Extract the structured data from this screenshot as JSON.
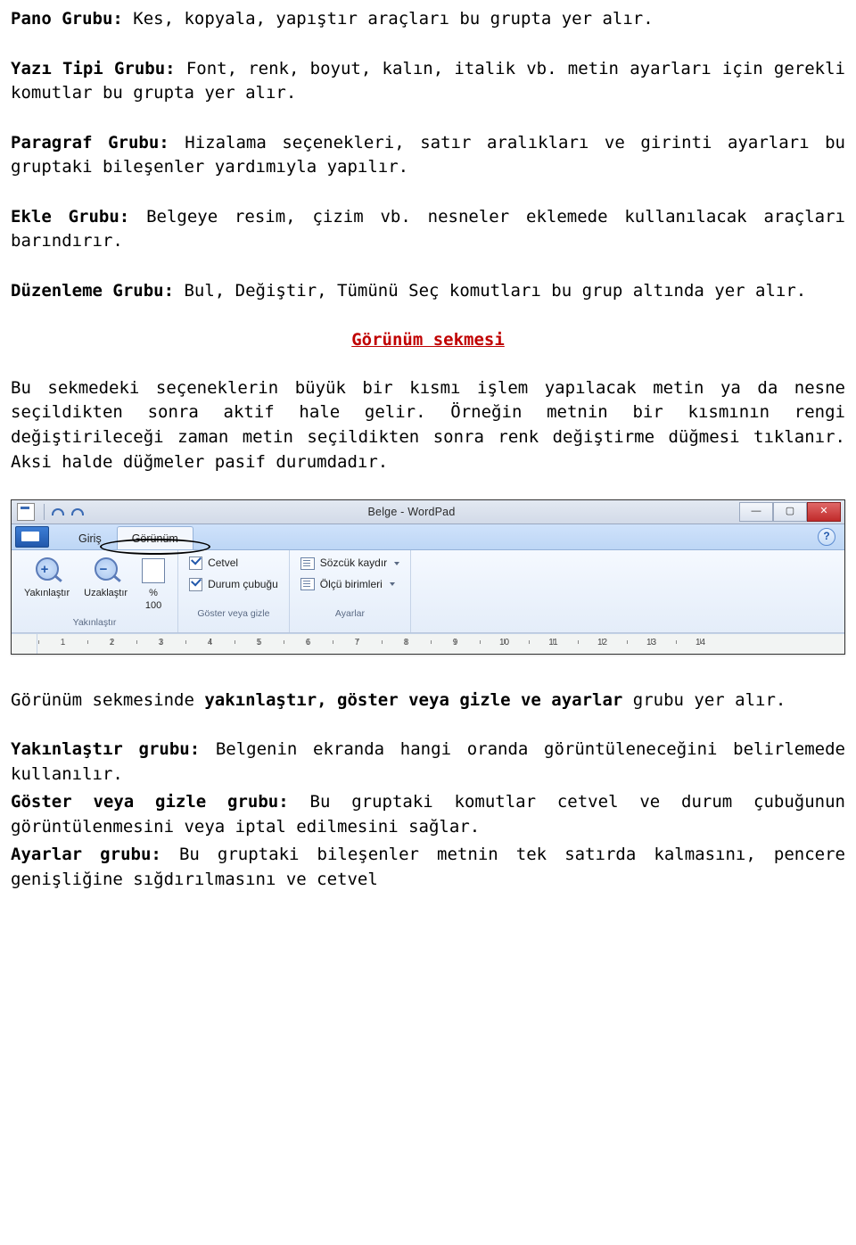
{
  "paragraphs": {
    "pano_label": "Pano Grubu:",
    "pano_rest": " Kes, kopyala, yapıştır araçları bu grupta yer alır.",
    "yazi_label": "Yazı Tipi Grubu:",
    "yazi_rest": " Font, renk, boyut, kalın, italik vb. metin ayarları için gerekli komutlar bu grupta yer alır.",
    "para_label": "Paragraf Grubu:",
    "para_rest": " Hizalama seçenekleri, satır aralıkları ve girinti ayarları bu gruptaki bileşenler yardımıyla yapılır.",
    "ekle_label": "Ekle Grubu:",
    "ekle_rest": " Belgeye resim, çizim vb. nesneler eklemede kullanılacak araçları barındırır.",
    "duz_label": "Düzenleme Grubu:",
    "duz_rest": " Bul, Değiştir, Tümünü Seç komutları bu grup altında yer alır.",
    "heading": "Görünüm sekmesi",
    "body1": "Bu sekmedeki seçeneklerin büyük bir kısmı işlem yapılacak metin ya da nesne seçildikten sonra aktif hale gelir. Örneğin metnin bir kısmının rengi değiştirileceği zaman metin seçildikten sonra renk değiştirme düğmesi tıklanır. Aksi halde düğmeler pasif durumdadır.",
    "body2a": "Görünüm sekmesinde ",
    "body2b": "yakınlaştır, göster veya gizle ve ayarlar",
    "body2c": " grubu yer alır.",
    "yakin_label": "Yakınlaştır grubu:",
    "yakin_rest": " Belgenin ekranda hangi oranda görüntüleneceğini belirlemede kullanılır.",
    "gost_label": "Göster veya gizle grubu:",
    "gost_rest": " Bu gruptaki komutlar cetvel ve durum çubuğunun görüntülenmesini veya iptal edilmesini sağlar.",
    "ayar_label": "Ayarlar grubu:",
    "ayar_rest": " Bu gruptaki bileşenler metnin tek satırda kalmasını, pencere genişliğine sığdırılmasını ve cetvel"
  },
  "screenshot": {
    "title": "Belge - WordPad",
    "tabs": {
      "home": "Giriş",
      "view": "Görünüm"
    },
    "help": "?",
    "window_buttons": {
      "minimize": "—",
      "maximize": "▢",
      "close": "✕"
    },
    "zoom_group": {
      "zoom_in": "Yakınlaştır",
      "zoom_out": "Uzaklaştır",
      "zoom_100a": "%",
      "zoom_100b": "100",
      "label": "Yakınlaştır"
    },
    "show_group": {
      "ruler": "Cetvel",
      "status": "Durum çubuğu",
      "label": "Göster veya gizle"
    },
    "settings_group": {
      "wrap": "Sözcük kaydır",
      "units": "Ölçü birimleri",
      "label": "Ayarlar"
    },
    "ruler_numbers": [
      "1",
      "2",
      "3",
      "4",
      "5",
      "6",
      "7",
      "8",
      "9",
      "10",
      "11",
      "12",
      "13",
      "14"
    ]
  }
}
